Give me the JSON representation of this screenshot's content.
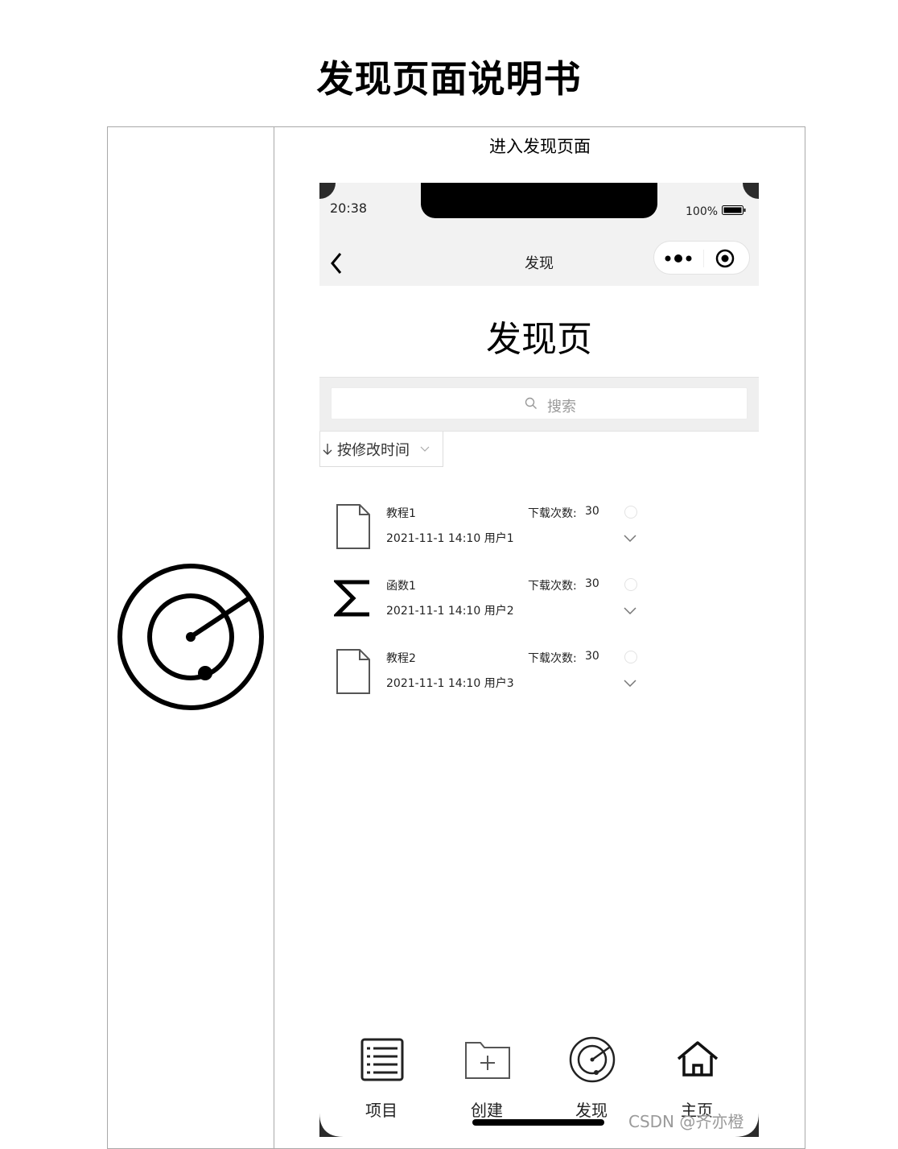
{
  "document": {
    "title": "发现页面说明书",
    "caption": "进入发现页面",
    "left_icon": "discover-radar-icon"
  },
  "status_bar": {
    "time": "20:38",
    "battery": "100%"
  },
  "nav_bar": {
    "title": "发现",
    "back_icon": "chevron-left-icon",
    "more_icon": "more-dots-icon",
    "close_icon": "record-circle-icon"
  },
  "page": {
    "heading": "发现页",
    "search": {
      "placeholder": "搜索",
      "icon": "search-icon"
    },
    "sort": {
      "label": "按修改时间"
    }
  },
  "files": [
    {
      "name": "教程1",
      "meta": "2021-11-1 14:10 用户1",
      "download_label": "下载次数:",
      "download_count": "30",
      "icon": "document-icon"
    },
    {
      "name": "函数1",
      "meta": "2021-11-1 14:10 用户2",
      "download_label": "下载次数:",
      "download_count": "30",
      "icon": "sigma-icon"
    },
    {
      "name": "教程2",
      "meta": "2021-11-1 14:10 用户3",
      "download_label": "下载次数:",
      "download_count": "30",
      "icon": "document-icon"
    }
  ],
  "tab_bar": [
    {
      "label": "项目",
      "icon": "list-icon"
    },
    {
      "label": "创建",
      "icon": "folder-plus-icon"
    },
    {
      "label": "发现",
      "icon": "radar-icon"
    },
    {
      "label": "主页",
      "icon": "home-icon"
    }
  ],
  "watermark": "CSDN @齐亦橙"
}
